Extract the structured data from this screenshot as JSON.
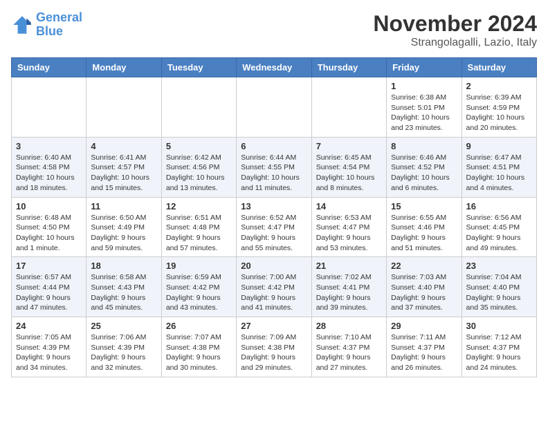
{
  "logo": {
    "line1": "General",
    "line2": "Blue"
  },
  "title": "November 2024",
  "location": "Strangolagalli, Lazio, Italy",
  "weekdays": [
    "Sunday",
    "Monday",
    "Tuesday",
    "Wednesday",
    "Thursday",
    "Friday",
    "Saturday"
  ],
  "weeks": [
    [
      {
        "day": "",
        "info": ""
      },
      {
        "day": "",
        "info": ""
      },
      {
        "day": "",
        "info": ""
      },
      {
        "day": "",
        "info": ""
      },
      {
        "day": "",
        "info": ""
      },
      {
        "day": "1",
        "info": "Sunrise: 6:38 AM\nSunset: 5:01 PM\nDaylight: 10 hours and 23 minutes."
      },
      {
        "day": "2",
        "info": "Sunrise: 6:39 AM\nSunset: 4:59 PM\nDaylight: 10 hours and 20 minutes."
      }
    ],
    [
      {
        "day": "3",
        "info": "Sunrise: 6:40 AM\nSunset: 4:58 PM\nDaylight: 10 hours and 18 minutes."
      },
      {
        "day": "4",
        "info": "Sunrise: 6:41 AM\nSunset: 4:57 PM\nDaylight: 10 hours and 15 minutes."
      },
      {
        "day": "5",
        "info": "Sunrise: 6:42 AM\nSunset: 4:56 PM\nDaylight: 10 hours and 13 minutes."
      },
      {
        "day": "6",
        "info": "Sunrise: 6:44 AM\nSunset: 4:55 PM\nDaylight: 10 hours and 11 minutes."
      },
      {
        "day": "7",
        "info": "Sunrise: 6:45 AM\nSunset: 4:54 PM\nDaylight: 10 hours and 8 minutes."
      },
      {
        "day": "8",
        "info": "Sunrise: 6:46 AM\nSunset: 4:52 PM\nDaylight: 10 hours and 6 minutes."
      },
      {
        "day": "9",
        "info": "Sunrise: 6:47 AM\nSunset: 4:51 PM\nDaylight: 10 hours and 4 minutes."
      }
    ],
    [
      {
        "day": "10",
        "info": "Sunrise: 6:48 AM\nSunset: 4:50 PM\nDaylight: 10 hours and 1 minute."
      },
      {
        "day": "11",
        "info": "Sunrise: 6:50 AM\nSunset: 4:49 PM\nDaylight: 9 hours and 59 minutes."
      },
      {
        "day": "12",
        "info": "Sunrise: 6:51 AM\nSunset: 4:48 PM\nDaylight: 9 hours and 57 minutes."
      },
      {
        "day": "13",
        "info": "Sunrise: 6:52 AM\nSunset: 4:47 PM\nDaylight: 9 hours and 55 minutes."
      },
      {
        "day": "14",
        "info": "Sunrise: 6:53 AM\nSunset: 4:47 PM\nDaylight: 9 hours and 53 minutes."
      },
      {
        "day": "15",
        "info": "Sunrise: 6:55 AM\nSunset: 4:46 PM\nDaylight: 9 hours and 51 minutes."
      },
      {
        "day": "16",
        "info": "Sunrise: 6:56 AM\nSunset: 4:45 PM\nDaylight: 9 hours and 49 minutes."
      }
    ],
    [
      {
        "day": "17",
        "info": "Sunrise: 6:57 AM\nSunset: 4:44 PM\nDaylight: 9 hours and 47 minutes."
      },
      {
        "day": "18",
        "info": "Sunrise: 6:58 AM\nSunset: 4:43 PM\nDaylight: 9 hours and 45 minutes."
      },
      {
        "day": "19",
        "info": "Sunrise: 6:59 AM\nSunset: 4:42 PM\nDaylight: 9 hours and 43 minutes."
      },
      {
        "day": "20",
        "info": "Sunrise: 7:00 AM\nSunset: 4:42 PM\nDaylight: 9 hours and 41 minutes."
      },
      {
        "day": "21",
        "info": "Sunrise: 7:02 AM\nSunset: 4:41 PM\nDaylight: 9 hours and 39 minutes."
      },
      {
        "day": "22",
        "info": "Sunrise: 7:03 AM\nSunset: 4:40 PM\nDaylight: 9 hours and 37 minutes."
      },
      {
        "day": "23",
        "info": "Sunrise: 7:04 AM\nSunset: 4:40 PM\nDaylight: 9 hours and 35 minutes."
      }
    ],
    [
      {
        "day": "24",
        "info": "Sunrise: 7:05 AM\nSunset: 4:39 PM\nDaylight: 9 hours and 34 minutes."
      },
      {
        "day": "25",
        "info": "Sunrise: 7:06 AM\nSunset: 4:39 PM\nDaylight: 9 hours and 32 minutes."
      },
      {
        "day": "26",
        "info": "Sunrise: 7:07 AM\nSunset: 4:38 PM\nDaylight: 9 hours and 30 minutes."
      },
      {
        "day": "27",
        "info": "Sunrise: 7:09 AM\nSunset: 4:38 PM\nDaylight: 9 hours and 29 minutes."
      },
      {
        "day": "28",
        "info": "Sunrise: 7:10 AM\nSunset: 4:37 PM\nDaylight: 9 hours and 27 minutes."
      },
      {
        "day": "29",
        "info": "Sunrise: 7:11 AM\nSunset: 4:37 PM\nDaylight: 9 hours and 26 minutes."
      },
      {
        "day": "30",
        "info": "Sunrise: 7:12 AM\nSunset: 4:37 PM\nDaylight: 9 hours and 24 minutes."
      }
    ]
  ]
}
